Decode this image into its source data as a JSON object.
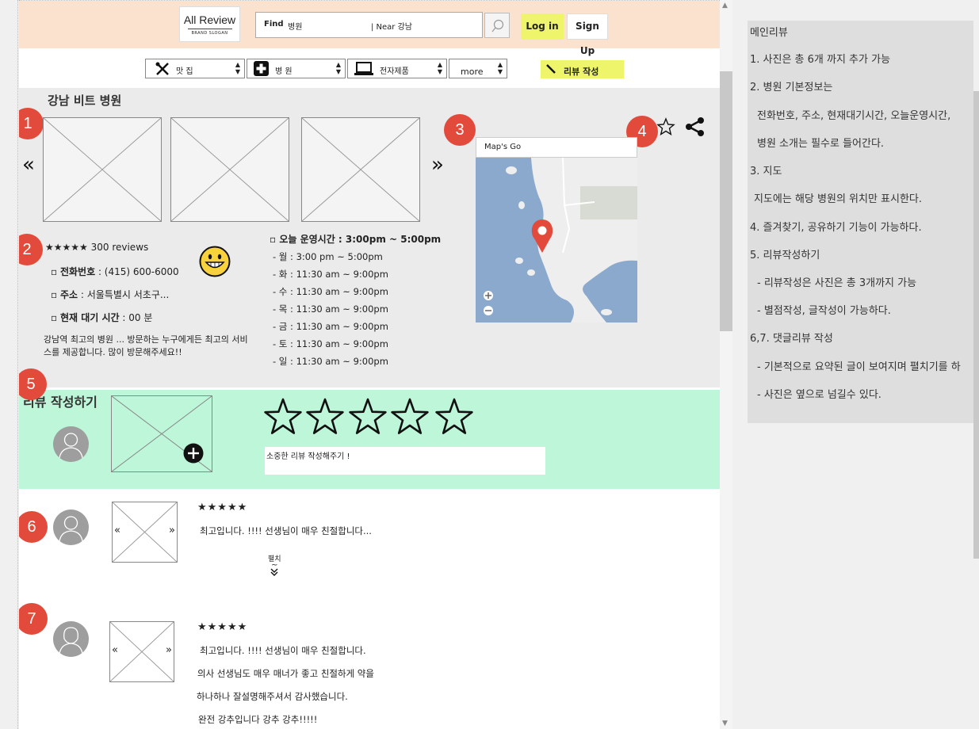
{
  "header": {
    "logo_name": "All Review",
    "logo_slogan": "BRAND SLOGAN",
    "search_find_label": "Find",
    "search_find_value": "병원",
    "search_near": "| Near 강남",
    "login": "Log in",
    "signup": "Sign Up"
  },
  "categories": [
    {
      "label": "맛 집",
      "icon": "fork-knife-icon"
    },
    {
      "label": "병 원",
      "icon": "medical-cross-icon"
    },
    {
      "label": "전자제품",
      "icon": "laptop-icon"
    },
    {
      "label": "more",
      "icon": ""
    }
  ],
  "write_review_button": "리뷰 작성",
  "hospital": {
    "name": "강남 비트 병원",
    "rating_text": "★★★★★ 300 reviews",
    "phone_label": "전화번호",
    "phone_value": " : (415) 600-6000",
    "address_label": "주소",
    "address_value": " : 서울특별시 서초구...",
    "wait_label": "현재 대기 시간",
    "wait_value": "  : 00 분",
    "description": "강남역 최고의 병원 ... 방문하는 누구에게든 최고의 서비스를 제공합니다. 많이 방문해주세요!!",
    "hours_title": "오늘 운영시간 : 3:00pm ~ 5:00pm",
    "hours": [
      "- 월 : 3:00 pm ~ 5:00pm",
      "- 화 : 11:30 am ~ 9:00pm",
      "- 수 : 11:30 am ~ 9:00pm",
      "- 목 : 11:30 am ~ 9:00pm",
      "- 금 : 11:30 am ~ 9:00pm",
      "- 토 : 11:30 am ~ 9:00pm",
      "- 일 : 11:30 am ~ 9:00pm"
    ],
    "map_search": "Map's Go"
  },
  "badges": [
    "1",
    "2",
    "3",
    "4",
    "5",
    "6",
    "7"
  ],
  "review_write": {
    "title": "리뷰 작성하기",
    "placeholder": "소중한 리뷰 작성해주기 !"
  },
  "reviews": [
    {
      "stars": "★★★★★",
      "text": "최고입니다. !!!! 선생님이 매우 친절합니다...",
      "expand_label": "펼치",
      "expand_mark": "~"
    },
    {
      "stars": "★★★★★",
      "lines": [
        "최고입니다. !!!! 선생님이 매우 친절합니다.",
        "의사 선생님도 매우 매너가 좋고 친절하게 약을",
        "하나하나 잘설명해주셔서 감사했습니다.",
        "완전 강추입니다 강추 강추!!!!!"
      ]
    }
  ],
  "notes": [
    "메인리뷰",
    "1. 사진은 총 6개 까지 추가 가능",
    "2. 병원 기본정보는",
    "전화번호, 주소, 현재대기시간, 오늘운영시간,",
    "병원 소개는 필수로 들어간다.",
    "3. 지도",
    "지도에는 해당 병원의 위치만 표시한다.",
    "4. 즐겨찾기, 공유하기 기능이 가능하다.",
    "5. 리뷰작성하기",
    "- 리뷰작성은 사진은 총 3개까지 가능",
    "- 별점작성, 글작성이 가능하다.",
    "6,7. 댓글리뷰 작성",
    "- 기본적으로 요약된 글이 보여지며 펼치기를 하",
    "-  사진은 옆으로 넘길수 있다."
  ],
  "colors": {
    "header_bg": "#fae2cf",
    "accent_yellow": "#eef56a",
    "badge_red": "#e24b3c",
    "review_write_bg": "#bdf6d9",
    "info_bg": "#ebebeb",
    "map_water": "#8aa9cc"
  }
}
